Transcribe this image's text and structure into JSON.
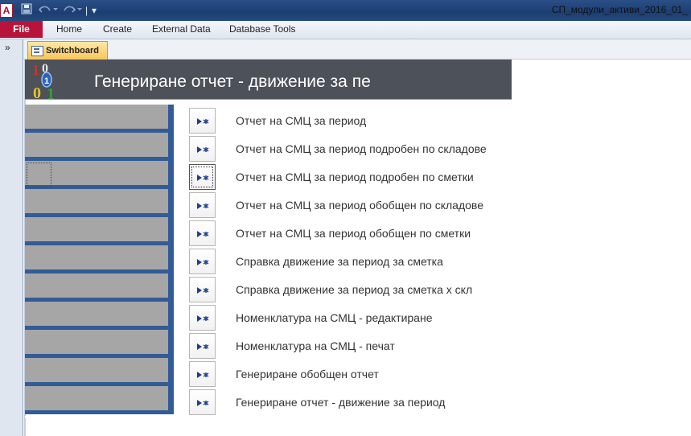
{
  "titlebar": {
    "window_title": "СП_модули_активи_2016_01_",
    "app_icon_letter": "A",
    "qat_separator": "|",
    "qat_customize_glyph": "▾"
  },
  "ribbon": {
    "file_tab": "File",
    "tabs": [
      "Home",
      "Create",
      "External Data",
      "Database Tools"
    ]
  },
  "nav_pane": {
    "toggle_glyph": "»"
  },
  "document_tab": {
    "label": "Switchboard",
    "icon": "form-icon"
  },
  "form": {
    "header_title": "Генериране отчет - движение за пе",
    "logo_icon": "binary-digits-logo",
    "items": [
      {
        "label": "Отчет на СМЦ за период"
      },
      {
        "label": "Отчет на СМЦ за период подробен по складове"
      },
      {
        "label": "Отчет на СМЦ за период подробен по сметки"
      },
      {
        "label": "Отчет на СМЦ за период обобщен по складове"
      },
      {
        "label": "Отчет на СМЦ за период обобщен по сметки"
      },
      {
        "label": "Справка движение за период за сметка"
      },
      {
        "label": "Справка движение за период за сметка х скл"
      },
      {
        "label": "Номенклатура на СМЦ - редактиране"
      },
      {
        "label": "Номенклатура на СМЦ - печат"
      },
      {
        "label": "Генериране обобщен отчет"
      },
      {
        "label": "Генериране отчет - движение за период"
      }
    ],
    "focused_item_index": 2
  },
  "colors": {
    "title_bar": "#1d3e73",
    "file_tab": "#b8143a",
    "header_band": "#4d5159",
    "left_panel": "#335b96",
    "strip_gray": "#a6a6a6",
    "button_arrow": "#1c3f8f"
  }
}
